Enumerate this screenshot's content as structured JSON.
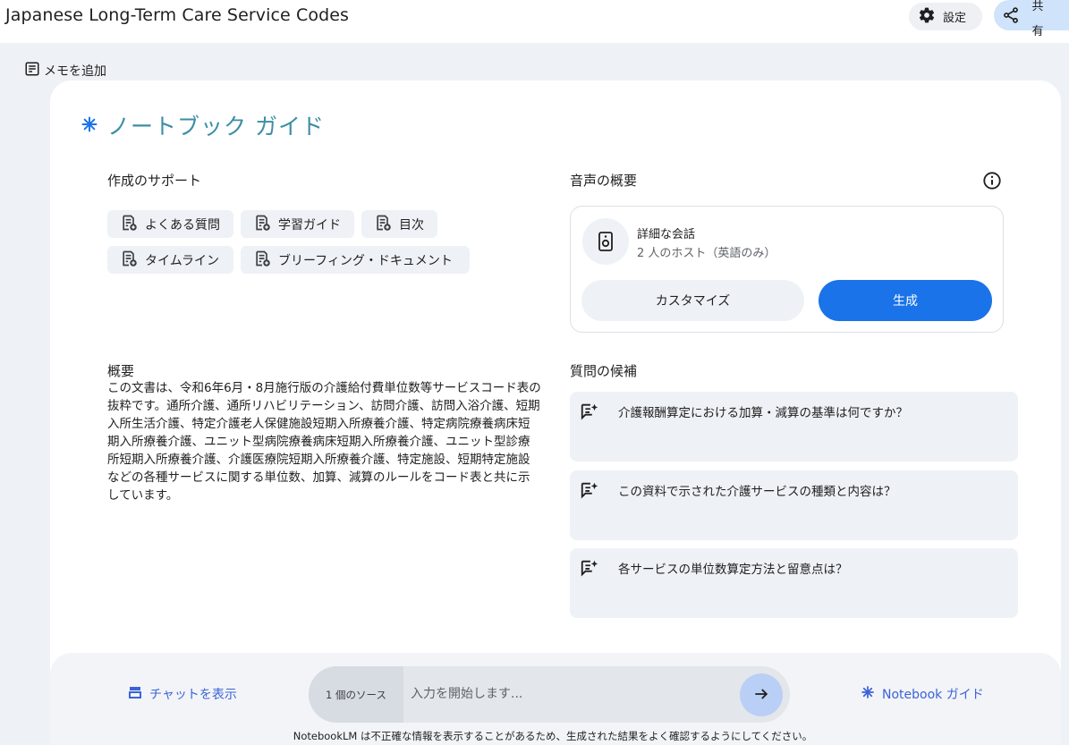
{
  "header": {
    "title": "Japanese Long-Term Care Service Codes",
    "settings_label": "設定",
    "share_label": "共有"
  },
  "add_memo_label": "メモを追加",
  "guide": {
    "title": "ノートブック ガイド",
    "support": {
      "heading": "作成のサポート",
      "chips": [
        "よくある質問",
        "学習ガイド",
        "目次",
        "タイムライン",
        "ブリーフィング・ドキュメント"
      ]
    },
    "summary": {
      "heading": "概要",
      "text": "この文書は、令和6年6月・8月施行版の介護給付費単位数等サービスコード表の抜粋です。通所介護、通所リハビリテーション、訪問介護、訪問入浴介護、短期入所生活介護、特定介護老人保健施設短期入所療養介護、特定病院療養病床短期入所療養介護、ユニット型病院療養病床短期入所療養介護、ユニット型診療所短期入所療養介護、介護医療院短期入所療養介護、特定施設、短期特定施設などの各種サービスに関する単位数、加算、減算のルールをコード表と共に示しています。"
    },
    "audio": {
      "heading": "音声の概要",
      "title": "詳細な会話",
      "subtitle": "2 人のホスト（英語のみ）",
      "customize_label": "カスタマイズ",
      "generate_label": "生成"
    },
    "questions": {
      "heading": "質問の候補",
      "items": [
        "介護報酬算定における加算・減算の基準は何ですか？",
        "この資料で示された介護サービスの種類と内容は？",
        "各サービスの単位数算定方法と留意点は？"
      ]
    }
  },
  "bottom": {
    "show_chat_label": "チャットを表示",
    "source_count": "1 個のソース",
    "input_placeholder": "入力を開始します...",
    "notebook_guide_label": "Notebook ガイド",
    "disclaimer": "NotebookLM は不正確な情報を表示することがあるため、生成された結果をよく確認するようにしてください。"
  },
  "colors": {
    "accent": "#1a73e8",
    "title_teal": "#3b8ea5",
    "link_blue": "#3c63d6"
  }
}
